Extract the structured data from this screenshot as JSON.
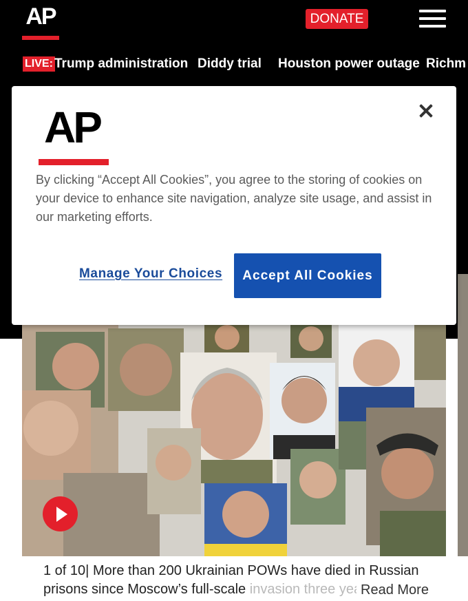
{
  "header": {
    "logo_text": "AP",
    "donate_label": "DONATE",
    "menu_icon": "hamburger-menu-icon"
  },
  "trending": {
    "live_label": "LIVE:",
    "items": [
      "Trump administration",
      "Diddy trial",
      "Houston power outage",
      "Richm"
    ]
  },
  "cookie_modal": {
    "logo_text": "AP",
    "close_icon": "close-icon",
    "message": "By clicking “Accept All Cookies”, you agree to the storing of cookies on your device to enhance site navigation, analyze site usage, and assist in our marketing efforts.",
    "manage_label": "Manage Your Choices",
    "accept_label": "Accept All Cookies"
  },
  "story": {
    "play_icon": "play-icon",
    "counter": "1 of 10",
    "separator": "|",
    "caption_line1": "More than 200 Ukrainian POWs have died in Russian",
    "caption_line2": "prisons since Moscow’s full-scale ",
    "caption_faded": "invasion three year",
    "read_more_label": "Read More"
  },
  "colors": {
    "brand_red": "#e3202b",
    "accept_blue": "#1551b0",
    "link_blue": "#1a4b9a",
    "header_bg": "#000000"
  }
}
